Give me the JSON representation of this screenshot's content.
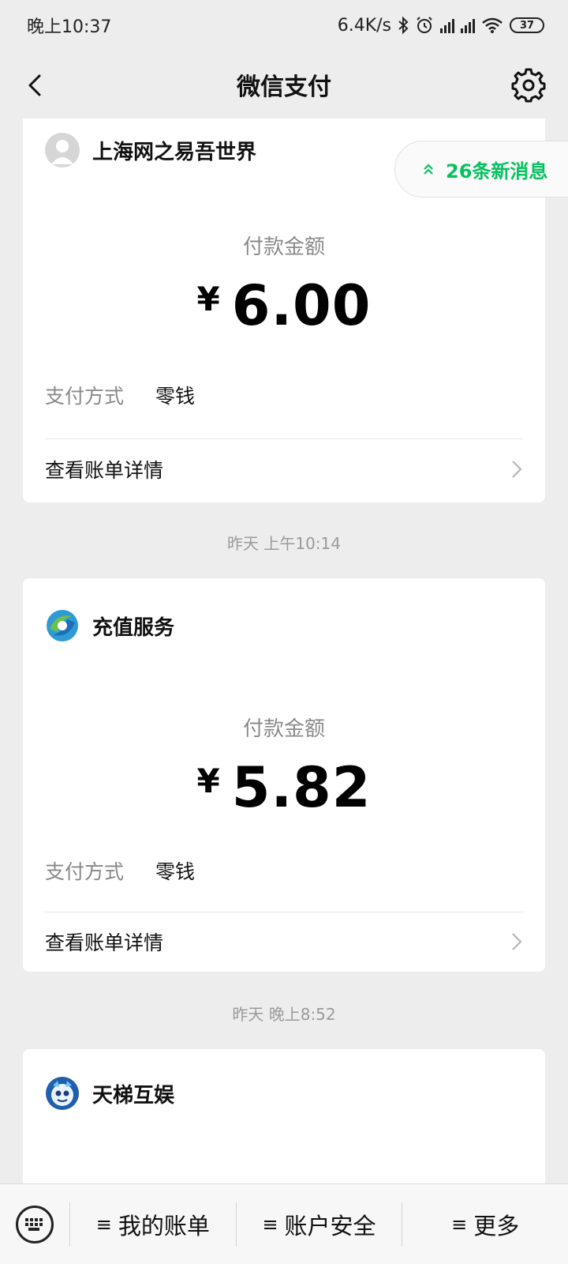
{
  "status_bar": {
    "time": "晚上10:37",
    "network_speed": "6.4K/s",
    "battery_level": "37",
    "icons": [
      "bluetooth-icon",
      "alarm-icon",
      "signal-hd-icon",
      "signal-hd-icon",
      "wifi-icon",
      "battery-icon"
    ]
  },
  "nav": {
    "title": "微信支付",
    "back_icon": "chevron-left-icon",
    "settings_icon": "gear-icon"
  },
  "new_messages": {
    "label": "26条新消息",
    "icon": "double-chevron-up-icon"
  },
  "cards": [
    {
      "merchant": "上海网之易吾世界",
      "avatar_icon": "default-avatar-icon",
      "amount_label": "付款金额",
      "currency": "¥",
      "amount": "6.00",
      "pay_method_label": "支付方式",
      "pay_method_value": "零钱",
      "detail_label": "查看账单详情"
    },
    {
      "merchant": "充值服务",
      "avatar_icon": "recharge-service-logo",
      "amount_label": "付款金额",
      "currency": "¥",
      "amount": "5.82",
      "pay_method_label": "支付方式",
      "pay_method_value": "零钱",
      "detail_label": "查看账单详情"
    },
    {
      "merchant": "天梯互娱",
      "avatar_icon": "tianti-logo"
    }
  ],
  "timestamps": [
    "昨天 上午10:14",
    "昨天 晚上8:52"
  ],
  "bottom_menu": {
    "keyboard_icon": "keyboard-icon",
    "items": [
      {
        "icon": "≡",
        "label": "我的账单"
      },
      {
        "icon": "≡",
        "label": "账户安全"
      },
      {
        "icon": "≡",
        "label": "更多"
      }
    ]
  },
  "colors": {
    "accent_green": "#07c160",
    "background": "#ededed",
    "card": "#ffffff"
  }
}
